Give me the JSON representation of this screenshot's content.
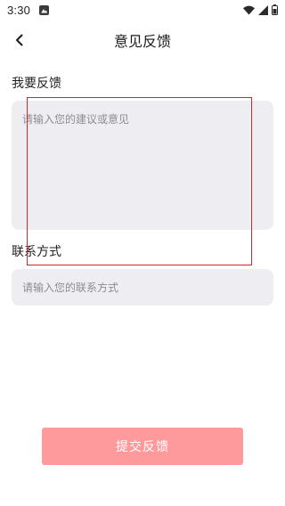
{
  "status_bar": {
    "time": "3:30",
    "icons": [
      "gallery-notification-icon",
      "wifi-icon",
      "signal-icon",
      "battery-icon"
    ]
  },
  "app_bar": {
    "back_icon": "chevron-left-icon",
    "title": "意见反馈"
  },
  "feedback": {
    "label": "我要反馈",
    "placeholder": "请输入您的建议或意见",
    "value": ""
  },
  "contact": {
    "label": "联系方式",
    "placeholder": "请输入您的联系方式",
    "value": ""
  },
  "submit": {
    "label": "提交反馈",
    "color": "#ff9a9c"
  },
  "colors": {
    "input_bg": "#eeeef2",
    "overlay_border": "#d6262b"
  }
}
